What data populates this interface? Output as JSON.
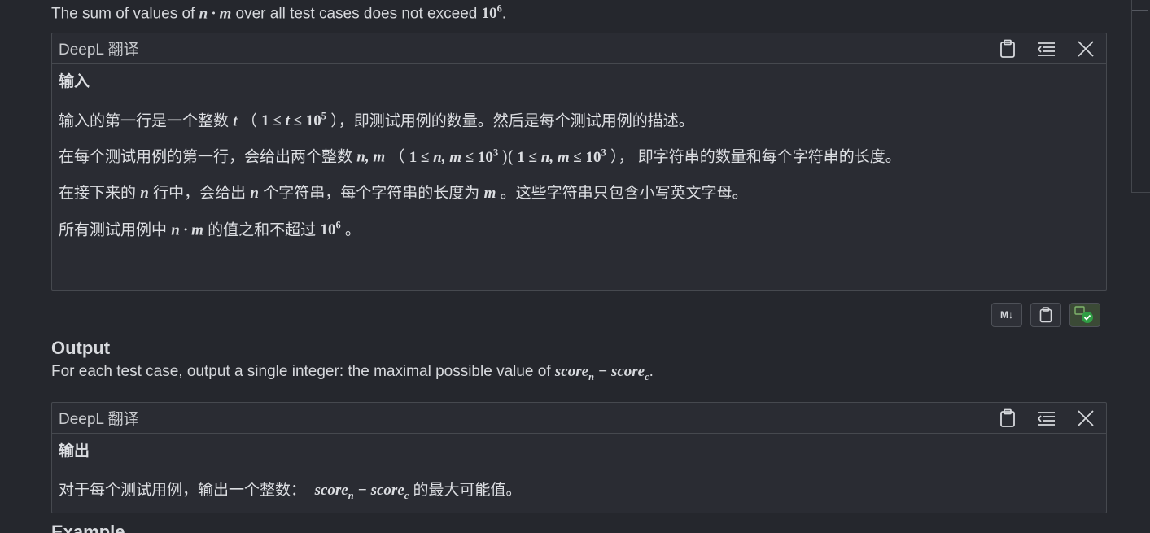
{
  "intro": {
    "text_before": "The sum of values of ",
    "math_nm": "n · m",
    "text_middle": " over all test cases does not exceed ",
    "pow_base": "10",
    "pow_exp": "6",
    "text_after": "."
  },
  "input_panel": {
    "title": "DeepL 翻译",
    "heading": "输入",
    "p1": {
      "a": "输入的第一行是一个整数 ",
      "var": "t",
      "b": "（ ",
      "range_a": "1 ≤ ",
      "range_var": "t",
      "range_b": " ≤ 10",
      "exp": "5",
      "c": " ），即测试用例的数量。然后是每个测试用例的描述。"
    },
    "p2": {
      "a": "在每个测试用例的第一行，会给出两个整数 ",
      "vars": "n, m",
      "b": "（ ",
      "r1a": "1 ≤ ",
      "r1v": "n, m",
      "r1b": " ≤ 10",
      "r1e": "3",
      "c": " )( ",
      "r2a": "1 ≤ ",
      "r2v": "n, m",
      "r2b": " ≤ 10",
      "r2e": "3",
      "d": " ）， 即字符串的数量和每个字符串的长度。"
    },
    "p3": {
      "a": "在接下来的 ",
      "v1": "n",
      "b": " 行中，会给出 ",
      "v2": "n",
      "c": " 个字符串，每个字符串的长度为 ",
      "v3": "m",
      "d": " 。这些字符串只包含小写英文字母。"
    },
    "p4": {
      "a": "所有测试用例中 ",
      "v": "n · m",
      "b": " 的值之和不超过 ",
      "base": "10",
      "exp": "6",
      "c": " 。"
    }
  },
  "tools": {
    "md_label": "M↓"
  },
  "output": {
    "title": "Output",
    "text_a": "For each test case, output a single integer: the maximal possible value of ",
    "score": "score",
    "sub_n": "n",
    "minus": " − ",
    "sub_c": "c",
    "text_b": "."
  },
  "output_panel": {
    "title": "DeepL 翻译",
    "heading": "输出",
    "a": "对于每个测试用例，输出一个整数： ",
    "b": " 的最大可能值。"
  },
  "example": {
    "title": "Example"
  }
}
